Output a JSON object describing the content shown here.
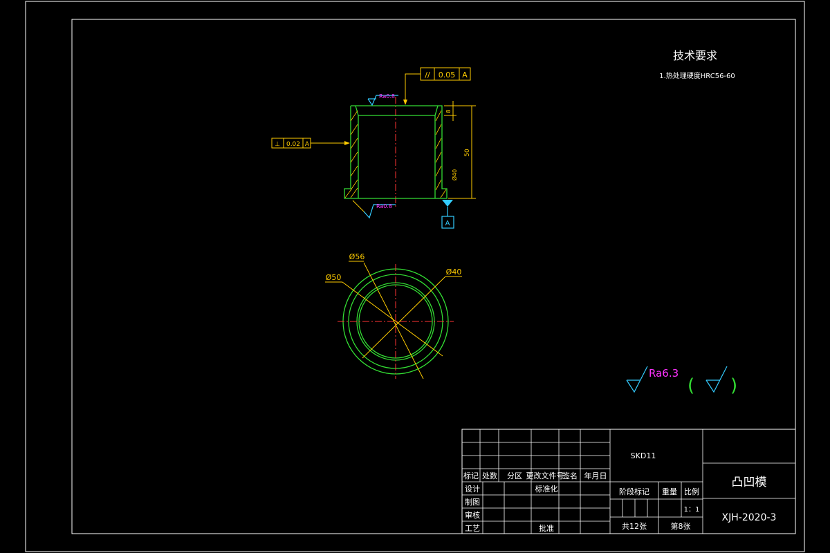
{
  "colors": {
    "background": "#000000",
    "frame": "#ffffff",
    "part_outline": "#33dd33",
    "dimension": "#ffcc00",
    "centerline": "#ff3333",
    "roughness_text": "#ff33ff",
    "datum": "#33ccff"
  },
  "tech_requirements": {
    "title": "技术要求",
    "item1": "1.热处理硬度HRC56-60"
  },
  "tolerances": {
    "parallel_symbol": "//",
    "parallel_value": "0.05",
    "parallel_datum": "A",
    "perp_symbol": "⊥",
    "perp_value": "0.02",
    "perp_datum": "A"
  },
  "roughness": {
    "top": "Ra0.8",
    "bottom": "Ra0.8",
    "general": "Ra6.3",
    "paren_open": "(",
    "paren_close": ")"
  },
  "dimensions": {
    "flange_height": "8",
    "total_height": "50",
    "side_dim": "Ø40",
    "dia_56": "Ø56",
    "dia_50": "Ø50",
    "dia_40": "Ø40"
  },
  "datum_label": "A",
  "title_block": {
    "row_headers": [
      "标记",
      "处数",
      "分区",
      "更改文件号",
      "签名",
      "年月日"
    ],
    "design": "设计",
    "standardization": "标准化",
    "drawing": "制图",
    "review": "审核",
    "process": "工艺",
    "approve": "批准",
    "stage_mark": "阶段标记",
    "weight": "重量",
    "scale": "比例",
    "scale_value": "1：1",
    "total_sheets": "共12张",
    "sheet_no": "第8张",
    "material": "SKD11",
    "part_name": "凸凹模",
    "drawing_no": "XJH-2020-3"
  }
}
